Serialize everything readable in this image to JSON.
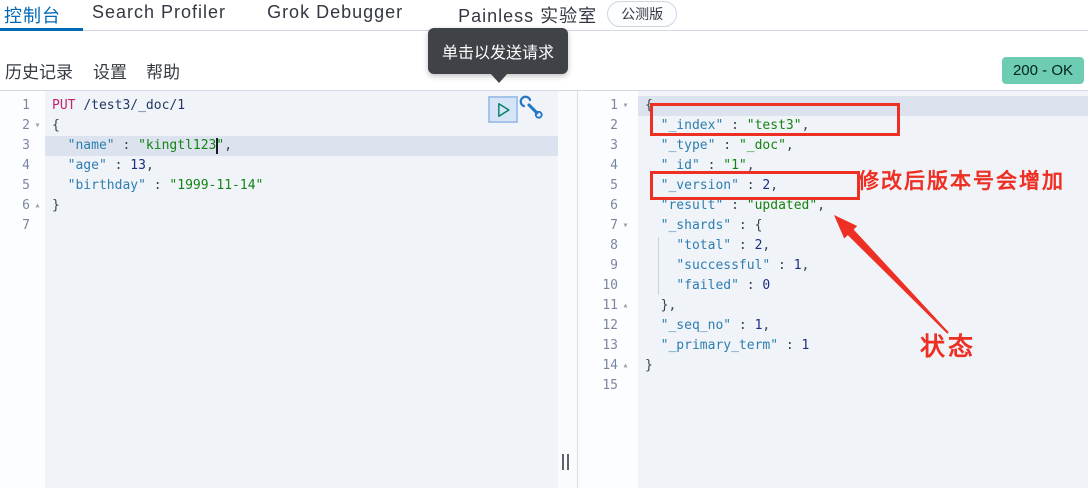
{
  "tabs": {
    "items": [
      {
        "label": "控制台",
        "active": true
      },
      {
        "label": "Search Profiler",
        "active": false
      },
      {
        "label": "Grok Debugger",
        "active": false
      },
      {
        "label": "Painless 实验室",
        "active": false
      }
    ],
    "beta_badge": "公测版"
  },
  "toolbar": {
    "history": "历史记录",
    "settings": "设置",
    "help": "帮助",
    "status_badge": "200 - OK"
  },
  "tooltip": {
    "text": "单击以发送请求"
  },
  "editor": {
    "active_line": 3,
    "line_numbers": [
      1,
      2,
      3,
      4,
      5,
      6,
      7
    ],
    "fold_markers": {
      "2": "down",
      "6": "up"
    },
    "lines": [
      [
        [
          "m",
          "PUT"
        ],
        [
          "p",
          " "
        ],
        [
          "u",
          "/test3/_doc/1"
        ]
      ],
      [
        [
          "p",
          "{"
        ]
      ],
      [
        [
          "p",
          "  "
        ],
        [
          "k",
          "\"name\""
        ],
        [
          "p",
          " : "
        ],
        [
          "s",
          "\"kingtl123\""
        ],
        [
          "p",
          ","
        ]
      ],
      [
        [
          "p",
          "  "
        ],
        [
          "k",
          "\"age\""
        ],
        [
          "p",
          " : "
        ],
        [
          "n",
          "13"
        ],
        [
          "p",
          ","
        ]
      ],
      [
        [
          "p",
          "  "
        ],
        [
          "k",
          "\"birthday\""
        ],
        [
          "p",
          " : "
        ],
        [
          "s",
          "\"1999-11-14\""
        ]
      ],
      [
        [
          "p",
          "}"
        ]
      ],
      []
    ]
  },
  "response": {
    "active_line": 1,
    "line_numbers": [
      1,
      2,
      3,
      4,
      5,
      6,
      7,
      8,
      9,
      10,
      11,
      12,
      13,
      14,
      15
    ],
    "fold_markers": {
      "1": "down",
      "7": "down",
      "11": "up",
      "14": "up"
    },
    "lines": [
      [
        [
          "p",
          "{"
        ]
      ],
      [
        [
          "p",
          "  "
        ],
        [
          "k",
          "\"_index\""
        ],
        [
          "p",
          " : "
        ],
        [
          "s",
          "\"test3\""
        ],
        [
          "p",
          ","
        ]
      ],
      [
        [
          "p",
          "  "
        ],
        [
          "k",
          "\"_type\""
        ],
        [
          "p",
          " : "
        ],
        [
          "s",
          "\"_doc\""
        ],
        [
          "p",
          ","
        ]
      ],
      [
        [
          "p",
          "  "
        ],
        [
          "k",
          "\"_id\""
        ],
        [
          "p",
          " : "
        ],
        [
          "s",
          "\"1\""
        ],
        [
          "p",
          ","
        ]
      ],
      [
        [
          "p",
          "  "
        ],
        [
          "k",
          "\"_version\""
        ],
        [
          "p",
          " : "
        ],
        [
          "n",
          "2"
        ],
        [
          "p",
          ","
        ]
      ],
      [
        [
          "p",
          "  "
        ],
        [
          "k",
          "\"result\""
        ],
        [
          "p",
          " : "
        ],
        [
          "s",
          "\"updated\""
        ],
        [
          "p",
          ","
        ]
      ],
      [
        [
          "p",
          "  "
        ],
        [
          "k",
          "\"_shards\""
        ],
        [
          "p",
          " : "
        ],
        [
          "p",
          "{"
        ]
      ],
      [
        [
          "p",
          "    "
        ],
        [
          "k",
          "\"total\""
        ],
        [
          "p",
          " : "
        ],
        [
          "n",
          "2"
        ],
        [
          "p",
          ","
        ]
      ],
      [
        [
          "p",
          "    "
        ],
        [
          "k",
          "\"successful\""
        ],
        [
          "p",
          " : "
        ],
        [
          "n",
          "1"
        ],
        [
          "p",
          ","
        ]
      ],
      [
        [
          "p",
          "    "
        ],
        [
          "k",
          "\"failed\""
        ],
        [
          "p",
          " : "
        ],
        [
          "n",
          "0"
        ]
      ],
      [
        [
          "p",
          "  },"
        ]
      ],
      [
        [
          "p",
          "  "
        ],
        [
          "k",
          "\"_seq_no\""
        ],
        [
          "p",
          " : "
        ],
        [
          "n",
          "1"
        ],
        [
          "p",
          ","
        ]
      ],
      [
        [
          "p",
          "  "
        ],
        [
          "k",
          "\"_primary_term\""
        ],
        [
          "p",
          " : "
        ],
        [
          "n",
          "1"
        ]
      ],
      [
        [
          "p",
          "}"
        ]
      ],
      []
    ]
  },
  "annotations": {
    "version_note": "修改后版本号会增加",
    "status_note": "状态"
  },
  "colors": {
    "accent": "#0068b4",
    "success_badge": "#6dccb1",
    "annotation_red": "#ee2f24",
    "method": "#c4226d",
    "key": "#2e7eb0",
    "string": "#148414",
    "number": "#1a2e80"
  }
}
